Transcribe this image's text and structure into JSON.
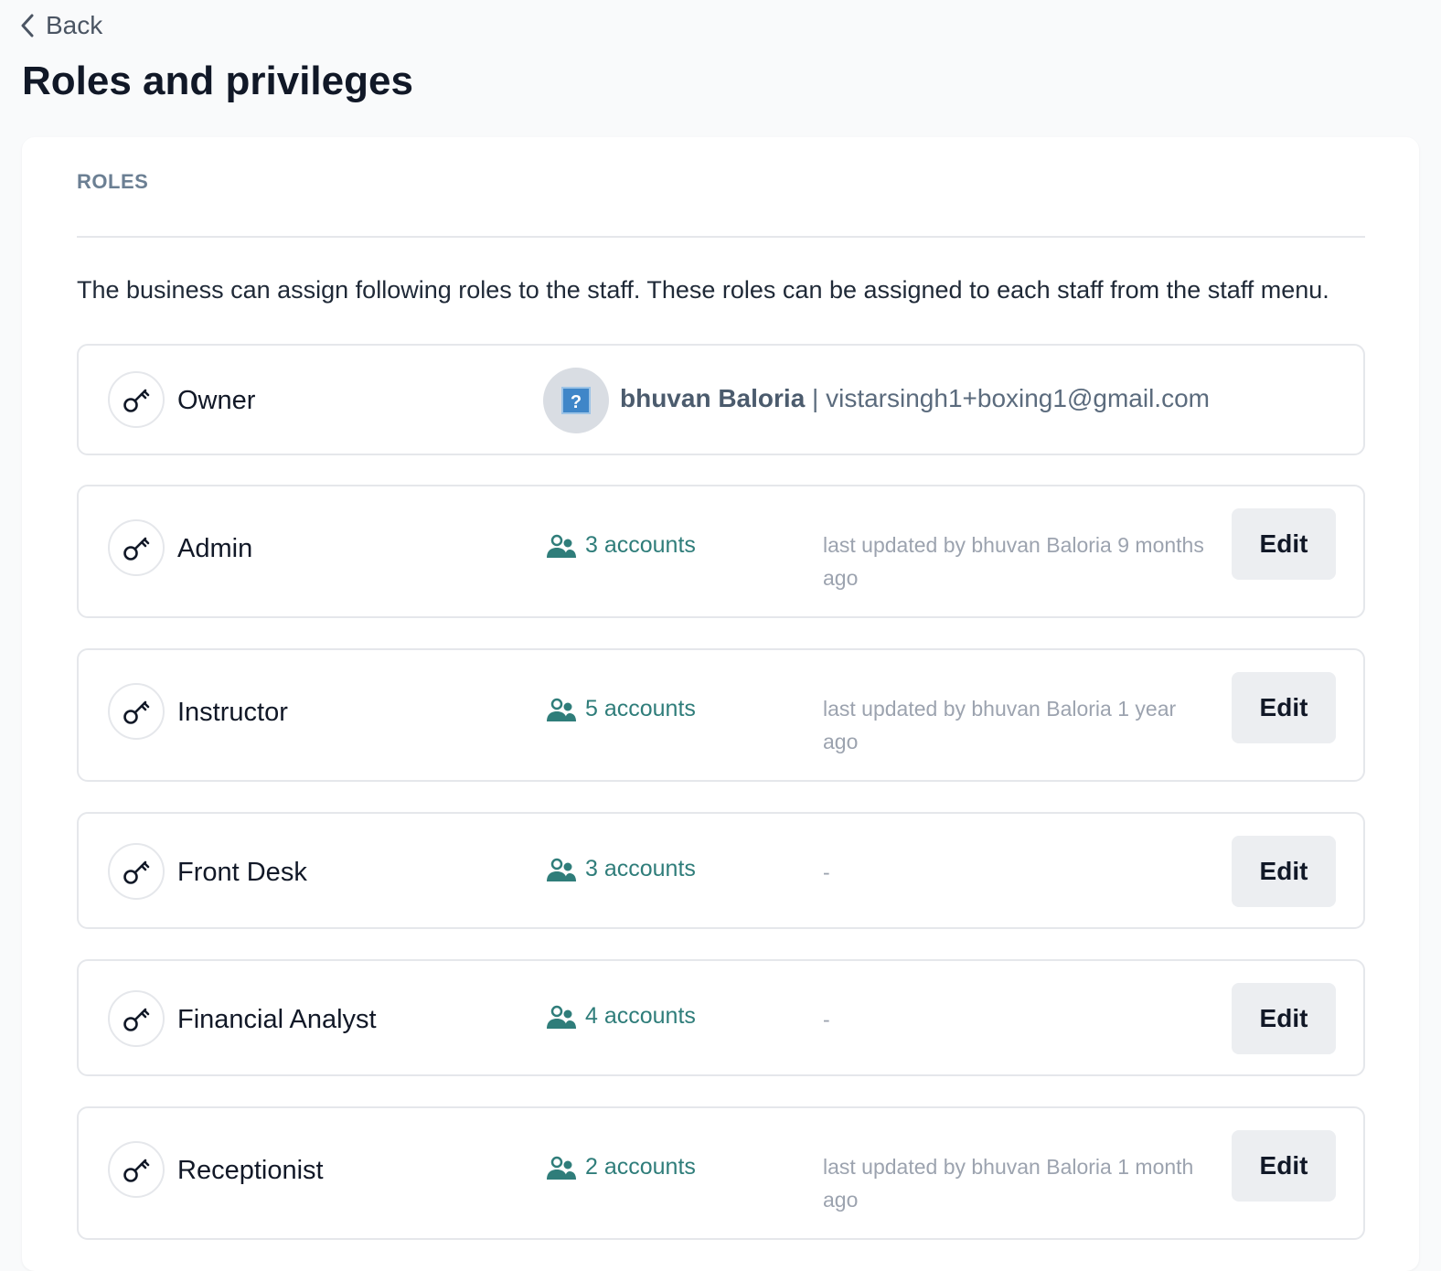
{
  "header": {
    "back_label": "Back",
    "title": "Roles and privileges"
  },
  "section": {
    "label": "ROLES",
    "description": "The business can assign following roles to the staff. These roles can be assigned to each staff from the staff menu."
  },
  "owner": {
    "role_name": "Owner",
    "user_name": "bhuvan Baloria",
    "separator": "|",
    "email": "vistarsingh1+boxing1@gmail.com"
  },
  "roles": [
    {
      "name": "Admin",
      "accounts": "3 accounts",
      "updated": "last updated by bhuvan Baloria 9 months ago",
      "edit_label": "Edit"
    },
    {
      "name": "Instructor",
      "accounts": "5 accounts",
      "updated": "last updated by bhuvan Baloria 1 year ago",
      "edit_label": "Edit"
    },
    {
      "name": "Front Desk",
      "accounts": "3 accounts",
      "updated": "-",
      "edit_label": "Edit"
    },
    {
      "name": "Financial Analyst",
      "accounts": "4 accounts",
      "updated": "-",
      "edit_label": "Edit"
    },
    {
      "name": "Receptionist",
      "accounts": "2 accounts",
      "updated": "last updated by bhuvan Baloria 1 month ago",
      "edit_label": "Edit"
    }
  ],
  "colors": {
    "accent_teal": "#2f7d7a",
    "muted_text": "#9ca3af",
    "edit_button_bg": "#eceef1"
  },
  "icons": {
    "back": "chevron-left-icon",
    "role": "key-icon",
    "accounts": "users-icon",
    "avatar_placeholder": "question-icon"
  }
}
